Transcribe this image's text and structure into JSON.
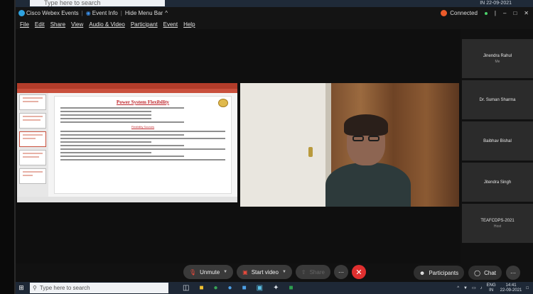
{
  "os_top": {
    "search_placeholder": "Type here to search",
    "tray_locale": "IN",
    "date": "22-09-2021"
  },
  "title_bar": {
    "app_name": "Cisco Webex Events",
    "event_info": "Event Info",
    "hide_menu": "Hide Menu Bar",
    "hide_menu_arrow": "^",
    "status": "Connected",
    "minimize": "–",
    "maximize": "□",
    "close": "✕"
  },
  "menu": [
    "File",
    "Edit",
    "Share",
    "View",
    "Audio & Video",
    "Participant",
    "Event",
    "Help"
  ],
  "presentation": {
    "slide_title": "Power System Flexibility",
    "subheading": "Flexibility Sources"
  },
  "participants": [
    {
      "name": "Jinendra Rahul",
      "role": "Me"
    },
    {
      "name": "Dr. Suman Sharma",
      "role": ""
    },
    {
      "name": "Baibhav Bishal",
      "role": ""
    },
    {
      "name": "Jitendra Singh",
      "role": ""
    },
    {
      "name": "TEAFCDPS-2021",
      "role": "Host"
    }
  ],
  "controls": {
    "unmute": "Unmute",
    "start_video": "Start video",
    "share": "Share",
    "participants": "Participants",
    "chat": "Chat"
  },
  "taskbar": {
    "search_placeholder": "Type here to search",
    "lang": "ENG",
    "locale": "IN",
    "time": "14:41",
    "date": "22-09-2021"
  },
  "colors": {
    "connected_dot": "#ec5b2a",
    "leave_button": "#e02f2f",
    "slide_title": "#c0272d"
  }
}
